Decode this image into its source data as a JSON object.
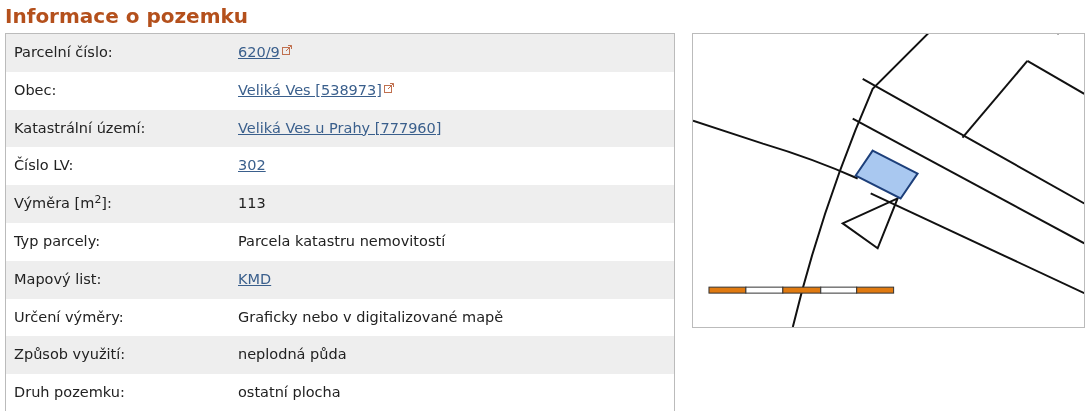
{
  "title": "Informace o pozemku",
  "rows": [
    {
      "label": "Parcelní číslo:",
      "value": "620/9",
      "kind": "link",
      "external": true
    },
    {
      "label": "Obec:",
      "value": "Veliká Ves [538973]",
      "kind": "link",
      "external": true
    },
    {
      "label": "Katastrální území:",
      "value": "Veliká Ves u Prahy [777960]",
      "kind": "link",
      "external": false
    },
    {
      "label": "Číslo LV:",
      "value": "302",
      "kind": "link",
      "external": false
    },
    {
      "label": "Výměra [m$^{2}$]:",
      "value": "113",
      "kind": "text",
      "external": false
    },
    {
      "label": "Typ parcely:",
      "value": "Parcela katastru nemovitostí",
      "kind": "text",
      "external": false
    },
    {
      "label": "Mapový list:",
      "value": "KMD",
      "kind": "link",
      "external": false
    },
    {
      "label": "Určení výměry:",
      "value": "Graficky nebo v digitalizované mapě",
      "kind": "text",
      "external": false
    },
    {
      "label": "Způsob využití:",
      "value": "neplodná půda",
      "kind": "text",
      "external": false
    },
    {
      "label": "Druh pozemku:",
      "value": "ostatní plocha",
      "kind": "text",
      "external": false
    }
  ]
}
